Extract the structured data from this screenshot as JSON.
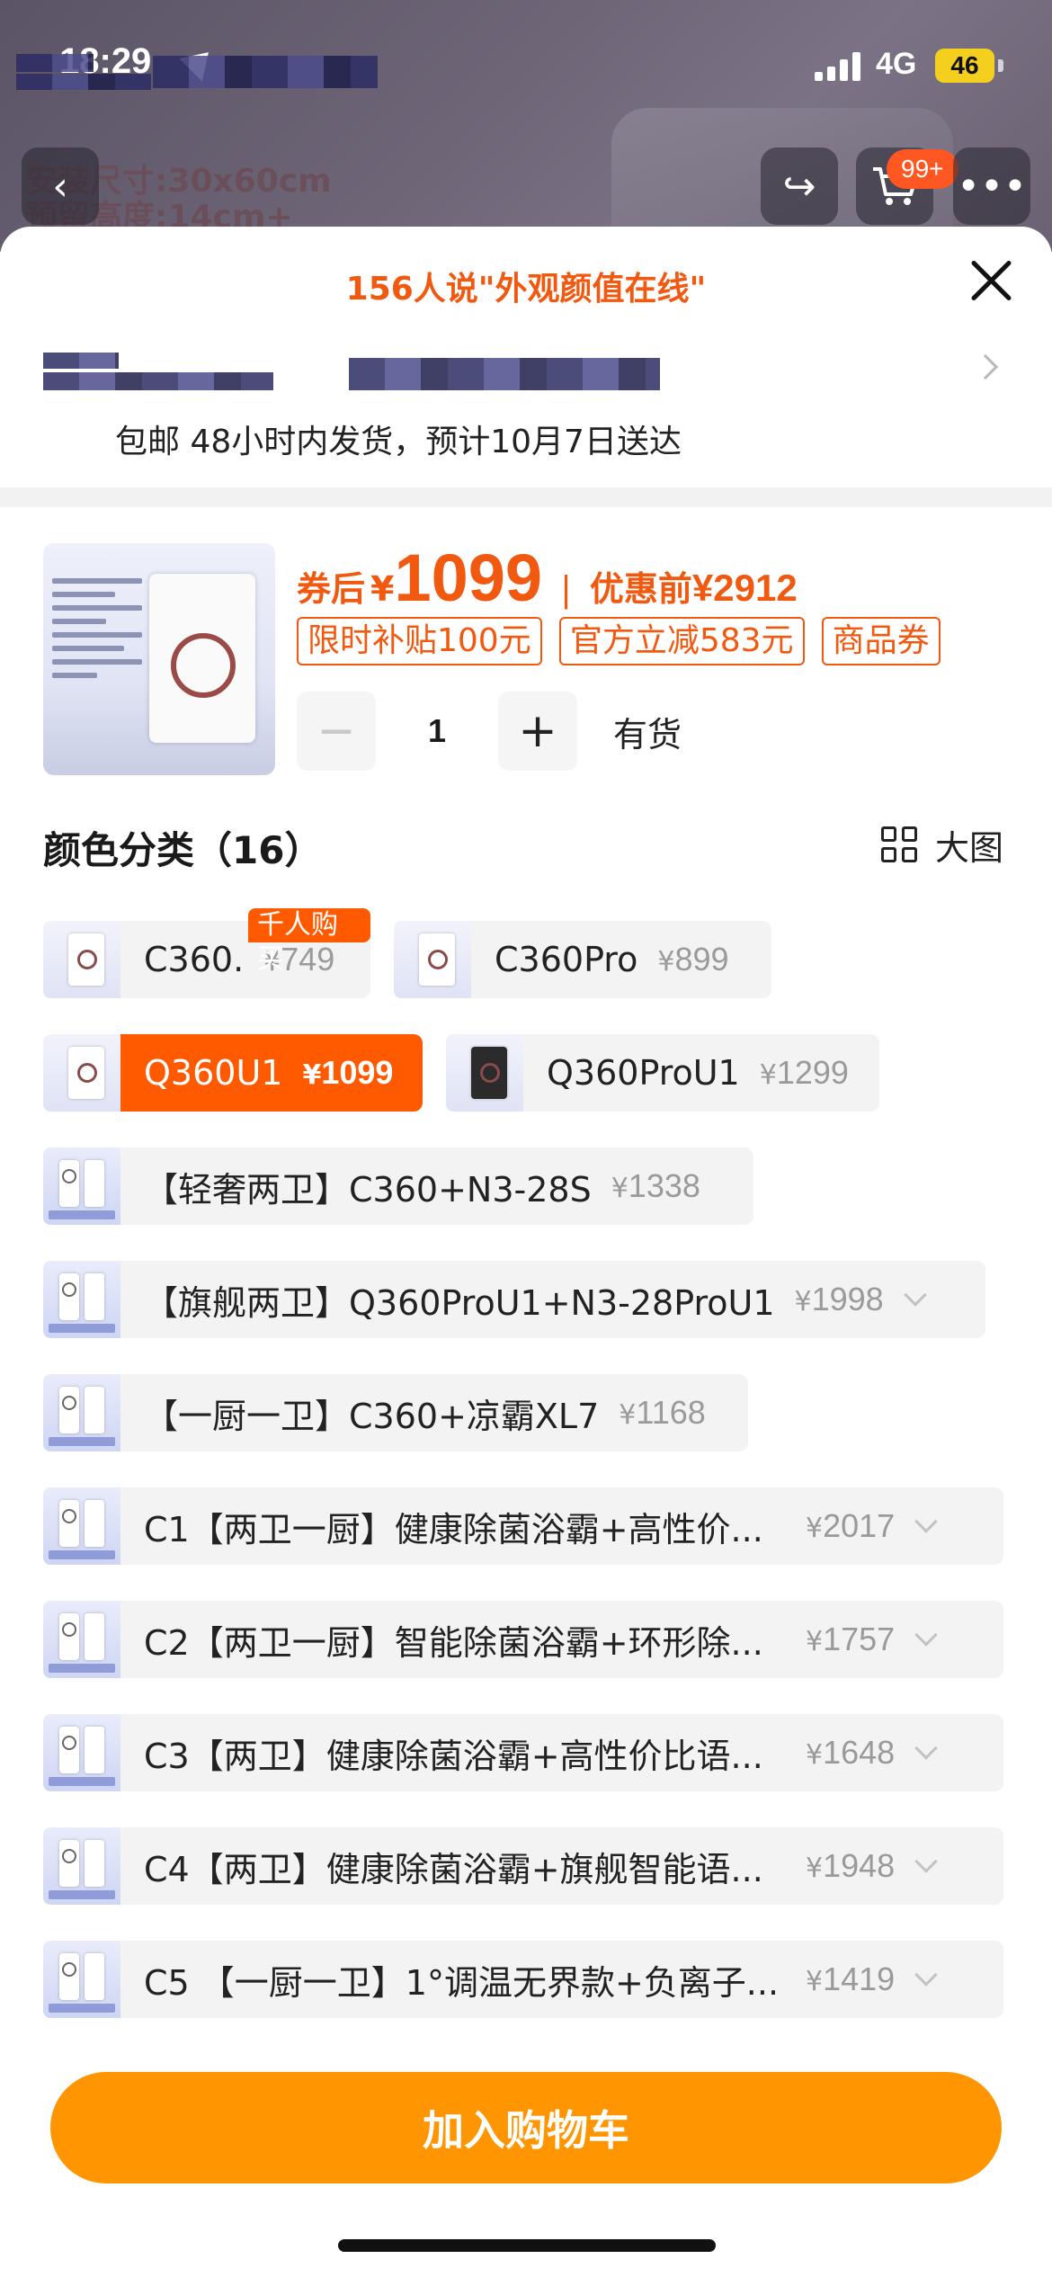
{
  "status_bar": {
    "time": "18:29",
    "network": "4G",
    "battery": "46"
  },
  "backdrop": {
    "spec_line1": "安装尺寸:30x60cm",
    "spec_line2": "预留高度:14cm+",
    "cart_badge": "99+"
  },
  "sheet": {
    "headline": "156人说\"外观颜值在线\"",
    "shipping": "包邮  48小时内发货，预计10月7日送达"
  },
  "summary": {
    "after_coupon_label": "券后",
    "yen": "¥",
    "price": "1099",
    "separator": "|",
    "before_label": "优惠前",
    "before_price": "¥2912",
    "tags": [
      "限时补贴100元",
      "官方立减583元",
      "商品券"
    ],
    "quantity": "1",
    "minus": "−",
    "plus": "+",
    "stock": "有货"
  },
  "colors": {
    "title": "颜色分类（16）",
    "big_image_label": "大图",
    "hot_tag": "千人购买",
    "options": [
      {
        "name": "C360.",
        "price": "749"
      },
      {
        "name": "C360Pro",
        "price": "899"
      },
      {
        "name": "Q360U1",
        "price": "1099"
      },
      {
        "name": "Q360ProU1",
        "price": "1299"
      },
      {
        "name": "【轻奢两卫】C360+N3-28S",
        "price": "1338"
      },
      {
        "name": "【旗舰两卫】Q360ProU1+N3-28ProU1",
        "price": "1998"
      },
      {
        "name": "【一厨一卫】C360+凉霸XL7",
        "price": "1168"
      },
      {
        "name": "C1【两卫一厨】健康除菌浴霸+高性价...",
        "price": "2017"
      },
      {
        "name": "C2【两卫一厨】智能除菌浴霸+环形除...",
        "price": "1757"
      },
      {
        "name": "C3【两卫】健康除菌浴霸+高性价比语...",
        "price": "1648"
      },
      {
        "name": "C4【两卫】健康除菌浴霸+旗舰智能语...",
        "price": "1948"
      },
      {
        "name": "C5 【一厨一卫】1°调温无界款+负离子...",
        "price": "1419"
      }
    ]
  },
  "actions": {
    "add_to_cart": "加入购物车"
  },
  "theme": {
    "accent": "#ff5a00",
    "cart_button": "#ff9500",
    "price_color": "#f0590f"
  }
}
